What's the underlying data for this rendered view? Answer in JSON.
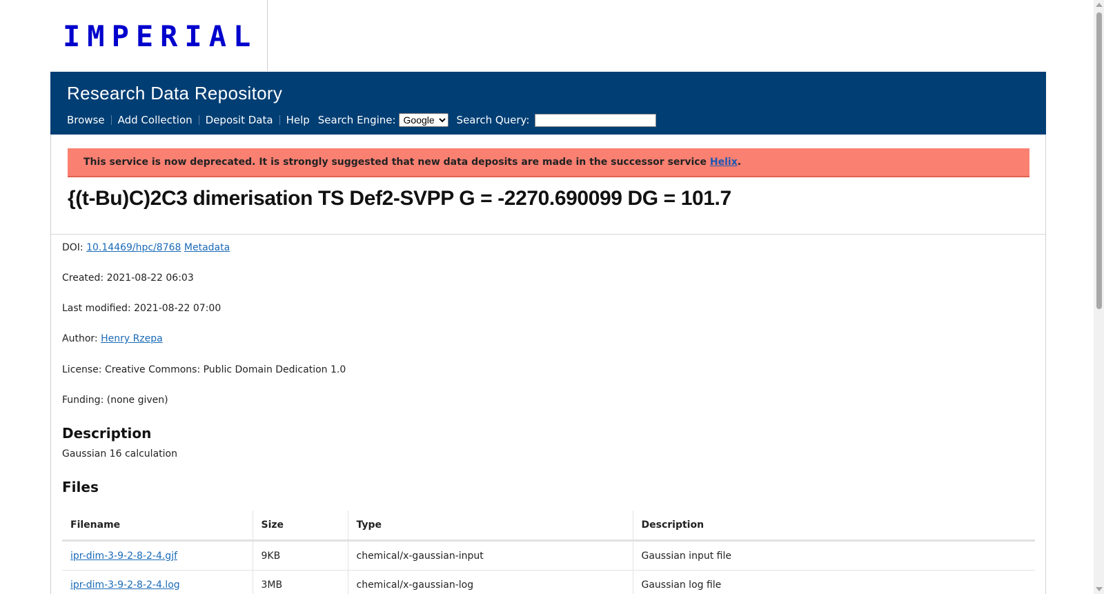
{
  "header": {
    "logo": "IMPERIAL"
  },
  "banner": {
    "title": "Research Data Repository",
    "nav": [
      "Browse",
      "Add Collection",
      "Deposit Data",
      "Help"
    ],
    "search_engine_label": "Search Engine:",
    "search_engine_value": "Google",
    "search_query_label": "Search Query:",
    "search_query_value": ""
  },
  "alert": {
    "text": "This service is now deprecated. It is strongly suggested that new data deposits are made in the successor service ",
    "link": "Helix",
    "suffix": "."
  },
  "page": {
    "title": "{(t-Bu)C)2C3 dimerisation TS Def2-SVPP G = -2270.690099 DG = 101.7"
  },
  "meta": {
    "doi_label": "DOI:",
    "doi": "10.14469/hpc/8768",
    "metadata_link": "Metadata",
    "created": "Created: 2021-08-22 06:03",
    "modified": "Last modified: 2021-08-22 07:00",
    "author_label": "Author:",
    "author": "Henry Rzepa",
    "license": "License: Creative Commons: Public Domain Dedication 1.0",
    "funding": "Funding: (none given)"
  },
  "description": {
    "heading": "Description",
    "text": "Gaussian 16 calculation"
  },
  "files": {
    "heading": "Files",
    "columns": [
      "Filename",
      "Size",
      "Type",
      "Description"
    ],
    "rows": [
      {
        "filename": "ipr-dim-3-9-2-8-2-4.gjf",
        "size": "9KB",
        "type": "chemical/x-gaussian-input",
        "description": "Gaussian input file"
      },
      {
        "filename": "ipr-dim-3-9-2-8-2-4.log",
        "size": "3MB",
        "type": "chemical/x-gaussian-log",
        "description": "Gaussian log file"
      }
    ]
  },
  "colors": {
    "banner": "#003e74",
    "logo": "#0000cd",
    "alert": "#fa8072",
    "link": "#1a6ab8"
  }
}
